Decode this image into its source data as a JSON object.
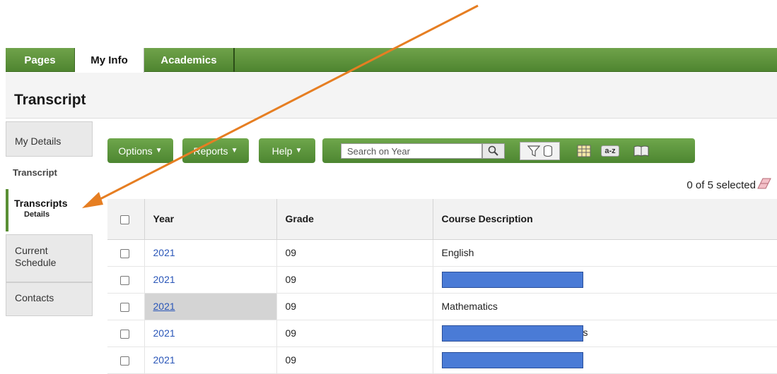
{
  "tabs": [
    {
      "label": "Pages"
    },
    {
      "label": "My Info"
    },
    {
      "label": "Academics"
    }
  ],
  "page": {
    "title": "Transcript"
  },
  "sidebar": {
    "my_details": "My Details",
    "section_label": "Transcript",
    "transcripts": {
      "label": "Transcripts",
      "sub": "Details"
    },
    "current_schedule_line1": "Current",
    "current_schedule_line2": "Schedule",
    "contacts": "Contacts"
  },
  "toolbar": {
    "options": "Options",
    "reports": "Reports",
    "help": "Help",
    "search_placeholder": "Search on Year"
  },
  "selection": {
    "text": "0 of 5 selected"
  },
  "table": {
    "headers": [
      "Year",
      "Grade",
      "Course Description"
    ],
    "rows": [
      {
        "year": "2021",
        "grade": "09",
        "course": "English"
      },
      {
        "year": "2021",
        "grade": "09",
        "course": ""
      },
      {
        "year": "2021",
        "grade": "09",
        "course": "Mathematics"
      },
      {
        "year": "2021",
        "grade": "09",
        "course": "s"
      },
      {
        "year": "2021",
        "grade": "09",
        "course": ""
      }
    ]
  },
  "colors": {
    "tab_green": "#5a9138",
    "arrow_orange": "#e67e22",
    "link_blue": "#2a56b8",
    "redaction_blue": "#4a7bd6"
  }
}
